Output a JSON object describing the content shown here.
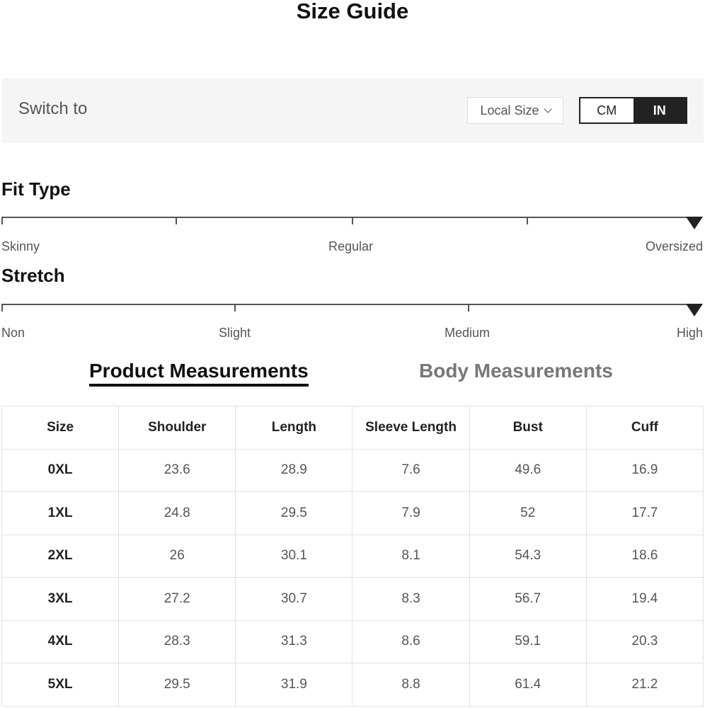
{
  "header": {
    "title": "Size Guide"
  },
  "switch_bar": {
    "label": "Switch to",
    "size_system": "Local Size",
    "units": [
      "CM",
      "IN"
    ],
    "selected_unit": "IN"
  },
  "fit_type": {
    "title": "Fit Type",
    "labels": [
      "Skinny",
      "Regular",
      "Oversized"
    ],
    "selected": "Oversized"
  },
  "stretch": {
    "title": "Stretch",
    "labels": [
      "Non",
      "Slight",
      "Medium",
      "High"
    ],
    "selected": "High"
  },
  "tabs": [
    {
      "label": "Product Measurements",
      "active": true
    },
    {
      "label": "Body Measurements",
      "active": false
    }
  ],
  "table": {
    "columns": [
      "Size",
      "Shoulder",
      "Length",
      "Sleeve Length",
      "Bust",
      "Cuff"
    ],
    "rows": [
      [
        "0XL",
        "23.6",
        "28.9",
        "7.6",
        "49.6",
        "16.9"
      ],
      [
        "1XL",
        "24.8",
        "29.5",
        "7.9",
        "52",
        "17.7"
      ],
      [
        "2XL",
        "26",
        "30.1",
        "8.1",
        "54.3",
        "18.6"
      ],
      [
        "3XL",
        "27.2",
        "30.7",
        "8.3",
        "56.7",
        "19.4"
      ],
      [
        "4XL",
        "28.3",
        "31.3",
        "8.6",
        "59.1",
        "20.3"
      ],
      [
        "5XL",
        "29.5",
        "31.9",
        "8.8",
        "61.4",
        "21.2"
      ]
    ]
  }
}
